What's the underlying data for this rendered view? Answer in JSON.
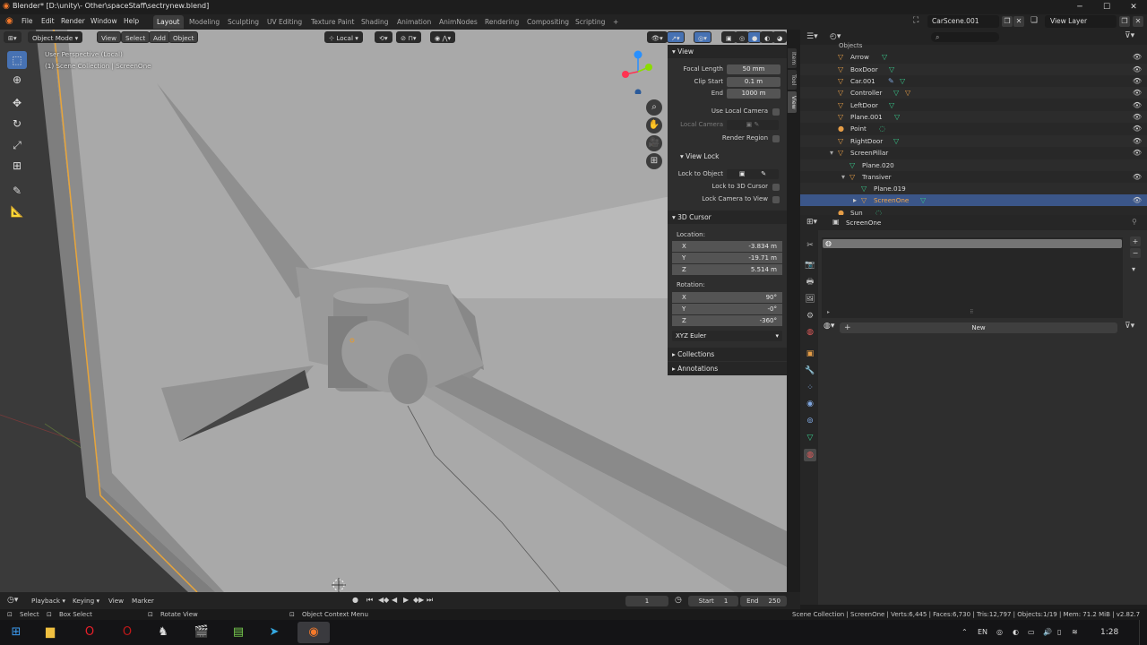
{
  "window": {
    "title": "Blender* [D:\\unity\\- Other\\spaceStaff\\sectrynew.blend]",
    "minimize": "─",
    "maximize": "☐",
    "close": "✕"
  },
  "menubar": {
    "items": [
      "File",
      "Edit",
      "Render",
      "Window",
      "Help"
    ],
    "workspaces": [
      "Layout",
      "Modeling",
      "Sculpting",
      "UV Editing",
      "Texture Paint",
      "Shading",
      "Animation",
      "AnimNodes",
      "Rendering",
      "Compositing",
      "Scripting"
    ],
    "active_workspace": "Layout",
    "add_tab": "+",
    "scene": "CarScene.001",
    "view_layer": "View Layer"
  },
  "viewport_header": {
    "mode": "Object Mode",
    "menus": [
      "View",
      "Select",
      "Add",
      "Object"
    ],
    "orientation": "Local"
  },
  "viewport": {
    "perspective": "User Perspective (Local)",
    "collection": "(1) Scene Collection | ScreenOne",
    "gizmo_x_color": "#ff3352",
    "gizmo_y_color": "#8bdc00",
    "gizmo_z_color": "#2890ff"
  },
  "npanel": {
    "view_header": "View",
    "focal_length_label": "Focal Length",
    "focal_length": "50 mm",
    "clip_start_label": "Clip Start",
    "clip_start": "0.1 m",
    "end_label": "End",
    "clip_end": "1000 m",
    "use_local_camera": "Use Local Camera",
    "local_camera": "Local Camera",
    "render_region": "Render Region",
    "view_lock_header": "View Lock",
    "lock_to_object": "Lock to Object",
    "lock_to_3d_cursor": "Lock to 3D Cursor",
    "lock_camera_to_view": "Lock Camera to View",
    "cursor_header": "3D Cursor",
    "location_label": "Location:",
    "loc_x": "-3.834 m",
    "loc_y": "-19.71 m",
    "loc_z": "5.514 m",
    "rotation_label": "Rotation:",
    "rot_x": "90°",
    "rot_y": "-0°",
    "rot_z": "-360°",
    "rotation_mode": "XYZ Euler",
    "collections": "Collections",
    "annotations": "Annotations",
    "axis_x": "X",
    "axis_y": "Y",
    "axis_z": "Z",
    "tabs": [
      "Item",
      "Tool",
      "View"
    ]
  },
  "outliner": {
    "header_group": "Objects",
    "rows": [
      {
        "name": "Arrow"
      },
      {
        "name": "BoxDoor"
      },
      {
        "name": "Car.001"
      },
      {
        "name": "Controller"
      },
      {
        "name": "LeftDoor"
      },
      {
        "name": "Plane.001"
      },
      {
        "name": "Point"
      },
      {
        "name": "RightDoor"
      },
      {
        "name": "ScreenPillar"
      },
      {
        "name": "Plane.020"
      },
      {
        "name": "Transiver"
      },
      {
        "name": "Plane.019"
      },
      {
        "name": "ScreenOne"
      },
      {
        "name": "Sun"
      }
    ]
  },
  "properties": {
    "object_name": "ScreenOne",
    "new_button": "New",
    "add": "+",
    "remove": "−"
  },
  "timeline": {
    "menus": [
      "Playback",
      "Keying",
      "View",
      "Marker"
    ],
    "current_frame": "1",
    "start_label": "Start",
    "start": "1",
    "end_label": "End",
    "end": "250"
  },
  "statusbar": {
    "select": "Select",
    "box_select": "Box Select",
    "rotate_view": "Rotate View",
    "context_menu": "Object Context Menu",
    "stats": "Scene Collection | ScreenOne | Verts:6,445 | Faces:6,730 | Tris:12,797 | Objects:1/19 | Mem: 71.2 MiB | v2.82.7"
  },
  "taskbar": {
    "language": "EN",
    "time": "1:28"
  }
}
